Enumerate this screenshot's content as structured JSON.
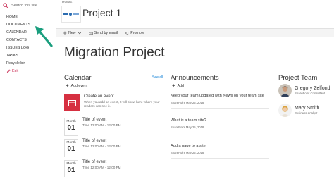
{
  "search": {
    "placeholder": "Search this site"
  },
  "nav": {
    "items": [
      "HOME",
      "DOCUMENTS",
      "CALENDAR",
      "CONTACTS",
      "ISSUES LOG",
      "TASKS",
      "Recycle bin"
    ],
    "edit": "Edit"
  },
  "header": {
    "breadcrumb": "HOME",
    "site_title": "Project 1"
  },
  "commands": {
    "new": "New",
    "send": "Send by email",
    "promote": "Promote"
  },
  "page": {
    "title": "Migration Project"
  },
  "calendar": {
    "title": "Calendar",
    "see_all": "See all",
    "add": "Add event",
    "create": {
      "title": "Create an event",
      "desc": "When you add an event, it will show here where your readers can see it."
    },
    "events": [
      {
        "month": "Month",
        "day": "01",
        "title": "Title of event",
        "time": "Time 12:00 AM - 12:00 PM"
      },
      {
        "month": "Month",
        "day": "01",
        "title": "Title of event",
        "time": "Time 12:00 AM - 12:00 PM"
      },
      {
        "month": "Month",
        "day": "01",
        "title": "Title of event",
        "time": "Time 12:00 AM - 12:00 PM"
      }
    ]
  },
  "announcements": {
    "title": "Announcements",
    "add": "Add",
    "items": [
      {
        "title": "Keep your team updated with News on your team site",
        "meta": "SharePoint  May 25, 2018"
      },
      {
        "title": "What is a team site?",
        "meta": "SharePoint  May 25, 2018"
      },
      {
        "title": "Add a page to a site",
        "meta": "SharePoint  May 25, 2018"
      }
    ]
  },
  "team": {
    "title": "Project Team",
    "people": [
      {
        "name": "Gregory Zelfond",
        "role": "SharePoint Consultant"
      },
      {
        "name": "Mary Smith",
        "role": "Business Analyst"
      }
    ]
  },
  "colors": {
    "accent": "#0078d4",
    "event_red": "#d63041",
    "arrow": "#1a9e7e"
  }
}
